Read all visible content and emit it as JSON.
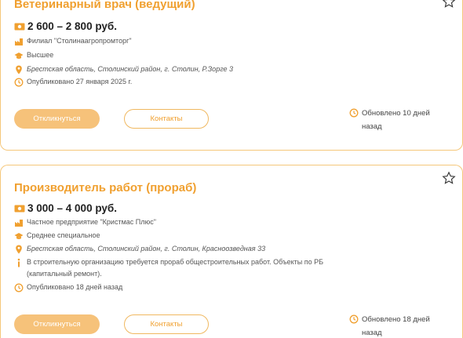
{
  "colors": {
    "accent": "#f0a030",
    "button_fill": "#f6c27a",
    "border": "#f5c77a"
  },
  "vacancies": [
    {
      "title": "Ветеринарный врач (ведущий)",
      "salary": "2 600 – 2 800 руб.",
      "employer": "Филиал \"Столинаагропромторг\"",
      "education": "Высшее",
      "address": "Брестская область, Столинский район, г. Столин, Р.Зорге 3",
      "published": "Опубликовано 27 января 2025 г.",
      "respond_label": "Откликнуться",
      "contacts_label": "Контакты",
      "updated": "Обновлено 10 дней назад"
    },
    {
      "title": "Производитель работ (прораб)",
      "salary": "3 000 – 4 000 руб.",
      "employer": "Частное предприятие \"Кристмас Плюс\"",
      "education": "Среднее специальное",
      "address": "Брестская область, Столинский район, г. Столин, Красноозведная 33",
      "description": "В строительную организацию требуется прораб общестроительных работ. Объекты по РБ (капитальный ремонт).",
      "published": "Опубликовано 18 дней назад",
      "respond_label": "Откликнуться",
      "contacts_label": "Контакты",
      "updated": "Обновлено 18 дней назад"
    }
  ]
}
